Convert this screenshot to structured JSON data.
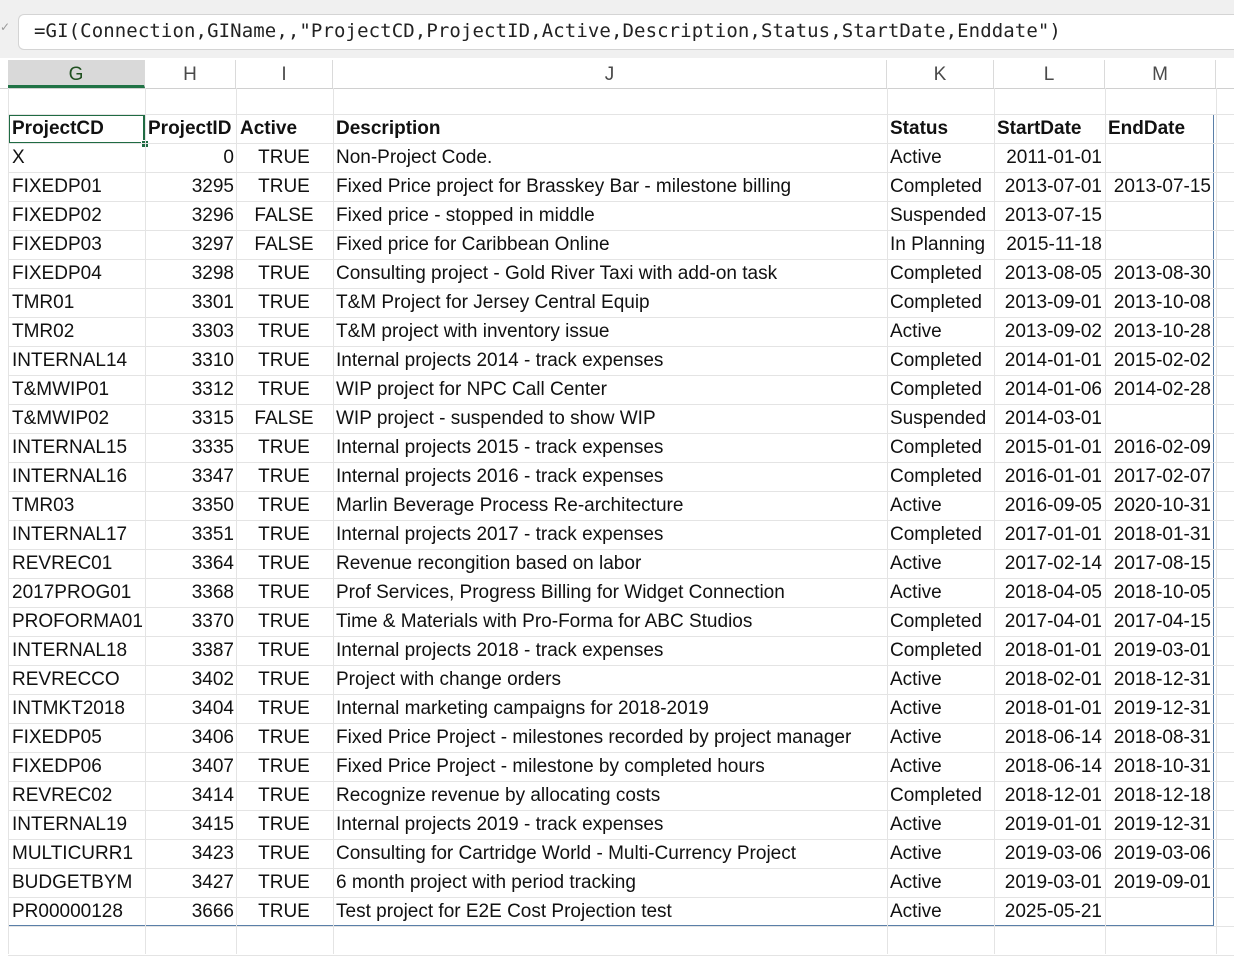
{
  "formula_bar": {
    "formula": "=GI(Connection,GIName,,\"ProjectCD,ProjectID,Active,Description,Status,StartDate,Enddate\")"
  },
  "column_headers": [
    "G",
    "H",
    "I",
    "J",
    "K",
    "L",
    "M"
  ],
  "selected_column": "G",
  "table": {
    "headers": [
      "ProjectCD",
      "ProjectID",
      "Active",
      "Description",
      "Status",
      "StartDate",
      "EndDate"
    ],
    "rows": [
      [
        "X",
        "0",
        "TRUE",
        "Non-Project Code.",
        "Active",
        "2011-01-01",
        ""
      ],
      [
        "FIXEDP01",
        "3295",
        "TRUE",
        "Fixed Price project for Brasskey Bar - milestone billing",
        "Completed",
        "2013-07-01",
        "2013-07-15"
      ],
      [
        "FIXEDP02",
        "3296",
        "FALSE",
        "Fixed price - stopped in middle",
        "Suspended",
        "2013-07-15",
        ""
      ],
      [
        "FIXEDP03",
        "3297",
        "FALSE",
        "Fixed price for Caribbean Online",
        "In Planning",
        "2015-11-18",
        ""
      ],
      [
        "FIXEDP04",
        "3298",
        "TRUE",
        "Consulting project - Gold River Taxi with add-on task",
        "Completed",
        "2013-08-05",
        "2013-08-30"
      ],
      [
        "TMR01",
        "3301",
        "TRUE",
        "T&M Project for Jersey Central Equip",
        "Completed",
        "2013-09-01",
        "2013-10-08"
      ],
      [
        "TMR02",
        "3303",
        "TRUE",
        "T&M project with inventory issue",
        "Active",
        "2013-09-02",
        "2013-10-28"
      ],
      [
        "INTERNAL14",
        "3310",
        "TRUE",
        "Internal projects 2014 - track expenses",
        "Completed",
        "2014-01-01",
        "2015-02-02"
      ],
      [
        "T&MWIP01",
        "3312",
        "TRUE",
        "WIP project for NPC Call Center",
        "Completed",
        "2014-01-06",
        "2014-02-28"
      ],
      [
        "T&MWIP02",
        "3315",
        "FALSE",
        "WIP project - suspended to show WIP",
        "Suspended",
        "2014-03-01",
        ""
      ],
      [
        "INTERNAL15",
        "3335",
        "TRUE",
        "Internal projects 2015 - track expenses",
        "Completed",
        "2015-01-01",
        "2016-02-09"
      ],
      [
        "INTERNAL16",
        "3347",
        "TRUE",
        "Internal projects 2016 - track expenses",
        "Completed",
        "2016-01-01",
        "2017-02-07"
      ],
      [
        "TMR03",
        "3350",
        "TRUE",
        "Marlin Beverage Process Re-architecture",
        "Active",
        "2016-09-05",
        "2020-10-31"
      ],
      [
        "INTERNAL17",
        "3351",
        "TRUE",
        "Internal projects 2017 - track expenses",
        "Completed",
        "2017-01-01",
        "2018-01-31"
      ],
      [
        "REVREC01",
        "3364",
        "TRUE",
        "Revenue recongition based on labor",
        "Active",
        "2017-02-14",
        "2017-08-15"
      ],
      [
        "2017PROG01",
        "3368",
        "TRUE",
        "Prof Services, Progress Billing for Widget Connection",
        "Active",
        "2018-04-05",
        "2018-10-05"
      ],
      [
        "PROFORMA01",
        "3370",
        "TRUE",
        "Time & Materials with Pro-Forma for ABC Studios",
        "Completed",
        "2017-04-01",
        "2017-04-15"
      ],
      [
        "INTERNAL18",
        "3387",
        "TRUE",
        "Internal projects 2018 - track expenses",
        "Completed",
        "2018-01-01",
        "2019-03-01"
      ],
      [
        "REVRECCO",
        "3402",
        "TRUE",
        "Project with change orders",
        "Active",
        "2018-02-01",
        "2018-12-31"
      ],
      [
        "INTMKT2018",
        "3404",
        "TRUE",
        "Internal marketing campaigns for 2018-2019",
        "Active",
        "2018-01-01",
        "2019-12-31"
      ],
      [
        "FIXEDP05",
        "3406",
        "TRUE",
        "Fixed Price Project - milestones recorded by project manager",
        "Active",
        "2018-06-14",
        "2018-08-31"
      ],
      [
        "FIXEDP06",
        "3407",
        "TRUE",
        "Fixed Price Project - milestone by completed hours",
        "Active",
        "2018-06-14",
        "2018-10-31"
      ],
      [
        "REVREC02",
        "3414",
        "TRUE",
        "Recognize revenue by allocating costs",
        "Completed",
        "2018-12-01",
        "2018-12-18"
      ],
      [
        "INTERNAL19",
        "3415",
        "TRUE",
        "Internal projects 2019 - track expenses",
        "Active",
        "2019-01-01",
        "2019-12-31"
      ],
      [
        "MULTICURR1",
        "3423",
        "TRUE",
        "Consulting for Cartridge World - Multi-Currency Project",
        "Active",
        "2019-03-06",
        "2019-03-06"
      ],
      [
        "BUDGETBYM",
        "3427",
        "TRUE",
        "6 month project with period tracking",
        "Active",
        "2019-03-01",
        "2019-09-01"
      ],
      [
        "PR00000128",
        "3666",
        "TRUE",
        "Test project for E2E Cost Projection test",
        "Active",
        "2025-05-21",
        ""
      ]
    ]
  },
  "colors": {
    "accent": "#217346",
    "table_border": "#5a7fa8",
    "gridline": "#e4e4e4"
  }
}
